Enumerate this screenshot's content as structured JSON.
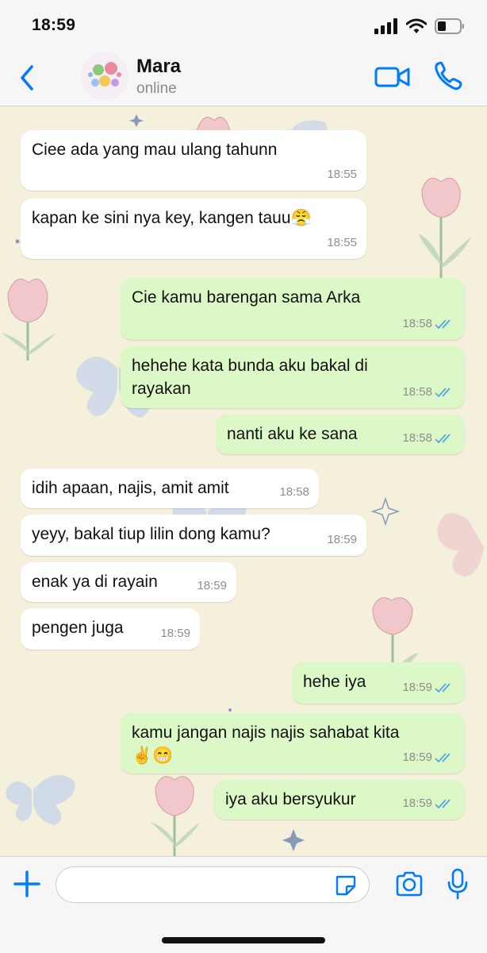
{
  "status_bar": {
    "time": "18:59"
  },
  "header": {
    "contact_name": "Mara",
    "contact_status": "online"
  },
  "messages": [
    {
      "dir": "in",
      "text": "Ciee ada yang mau ulang tahunn",
      "time": "18:55"
    },
    {
      "dir": "in",
      "text": "kapan ke sini nya key, kangen tauu😤",
      "time": "18:55"
    },
    {
      "dir": "out",
      "text": "Cie kamu barengan sama Arka",
      "time": "18:58",
      "status": "read"
    },
    {
      "dir": "out",
      "text": "hehehe kata bunda aku bakal di\nrayakan",
      "time": "18:58",
      "status": "read"
    },
    {
      "dir": "out",
      "text": "nanti aku ke sana",
      "time": "18:58",
      "status": "read"
    },
    {
      "dir": "in",
      "text": "idih apaan, najis, amit amit",
      "time": "18:58"
    },
    {
      "dir": "in",
      "text": "yeyy, bakal tiup lilin dong kamu?",
      "time": "18:59"
    },
    {
      "dir": "in",
      "text": "enak ya di rayain",
      "time": "18:59"
    },
    {
      "dir": "in",
      "text": "pengen juga",
      "time": "18:59"
    },
    {
      "dir": "out",
      "text": "hehe iya",
      "time": "18:59",
      "status": "read"
    },
    {
      "dir": "out",
      "text": "kamu jangan najis najis sahabat kita\n✌️😁",
      "time": "18:59",
      "status": "read"
    },
    {
      "dir": "out",
      "text": "iya aku bersyukur",
      "time": "18:59",
      "status": "read"
    }
  ],
  "input": {
    "value": "",
    "placeholder": ""
  },
  "icons": {
    "back": "chevron-left-icon",
    "video": "video-camera-icon",
    "call": "phone-icon",
    "plus": "plus-icon",
    "sticker": "sticker-icon",
    "camera": "camera-icon",
    "mic": "microphone-icon",
    "read_receipt": "double-check-icon"
  },
  "colors": {
    "accent": "#007aff",
    "incoming_bubble": "#ffffff",
    "outgoing_bubble": "#dcf8c6",
    "read_tick": "#4fa8e8",
    "wallpaper": "#f4f0dc"
  }
}
